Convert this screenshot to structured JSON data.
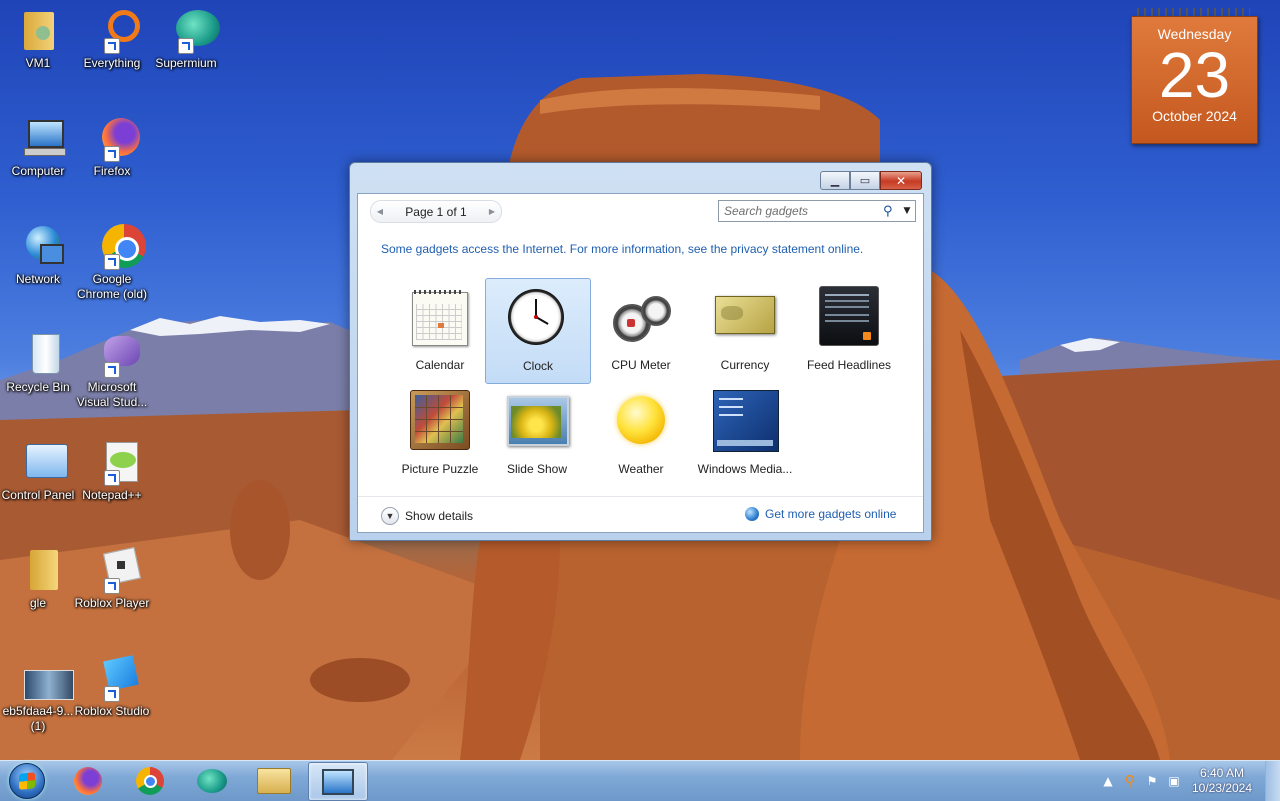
{
  "desktop_icons": [
    {
      "label": "VM1",
      "icon": "folder-user-icon",
      "shortcut": false
    },
    {
      "label": "Everything",
      "icon": "everything-search-icon",
      "shortcut": true
    },
    {
      "label": "Supermium",
      "icon": "supermium-browser-icon",
      "shortcut": true
    },
    {
      "label": "Computer",
      "icon": "computer-icon",
      "shortcut": false
    },
    {
      "label": "Firefox",
      "icon": "firefox-icon",
      "shortcut": true
    },
    {
      "label": "Network",
      "icon": "network-icon",
      "shortcut": false
    },
    {
      "label": "Google Chrome (old)",
      "icon": "chrome-icon",
      "shortcut": true
    },
    {
      "label": "Recycle Bin",
      "icon": "recycle-bin-icon",
      "shortcut": false
    },
    {
      "label": "Microsoft Visual Stud...",
      "icon": "visual-studio-icon",
      "shortcut": true
    },
    {
      "label": "Control Panel",
      "icon": "control-panel-icon",
      "shortcut": false
    },
    {
      "label": "Notepad++",
      "icon": "notepadpp-icon",
      "shortcut": true
    },
    {
      "label": "gle",
      "icon": "folder-icon",
      "shortcut": false
    },
    {
      "label": "Roblox Player",
      "icon": "roblox-player-icon",
      "shortcut": true
    },
    {
      "label": "eb5fdaa4-9... (1)",
      "icon": "image-file-icon",
      "shortcut": false
    },
    {
      "label": "Roblox Studio",
      "icon": "roblox-studio-icon",
      "shortcut": true
    }
  ],
  "calendar_gadget": {
    "weekday": "Wednesday",
    "day": "23",
    "month_year": "October 2024"
  },
  "gadget_window": {
    "pager": {
      "text": "Page 1 of 1"
    },
    "search": {
      "placeholder": "Search gadgets"
    },
    "info_text": "Some gadgets access the Internet.  For more information, see the privacy statement online.",
    "gadgets": [
      {
        "label": "Calendar",
        "icon": "calendar-gadget-icon",
        "selected": false
      },
      {
        "label": "Clock",
        "icon": "clock-gadget-icon",
        "selected": true
      },
      {
        "label": "CPU Meter",
        "icon": "cpu-meter-gadget-icon",
        "selected": false
      },
      {
        "label": "Currency",
        "icon": "currency-gadget-icon",
        "selected": false
      },
      {
        "label": "Feed Headlines",
        "icon": "feed-headlines-gadget-icon",
        "selected": false
      },
      {
        "label": "Picture Puzzle",
        "icon": "picture-puzzle-gadget-icon",
        "selected": false
      },
      {
        "label": "Slide Show",
        "icon": "slide-show-gadget-icon",
        "selected": false
      },
      {
        "label": "Weather",
        "icon": "weather-gadget-icon",
        "selected": false
      },
      {
        "label": "Windows Media...",
        "icon": "windows-media-gadget-icon",
        "selected": false
      }
    ],
    "show_details": "Show details",
    "get_more": "Get more gadgets online"
  },
  "taskbar": {
    "pinned": [
      {
        "icon": "firefox-icon"
      },
      {
        "icon": "chrome-icon"
      },
      {
        "icon": "supermium-browser-icon"
      },
      {
        "icon": "file-explorer-icon"
      },
      {
        "icon": "gadgets-icon",
        "active": true
      }
    ],
    "clock": {
      "time": "6:40 AM",
      "date": "10/23/2024"
    }
  },
  "colors": {
    "accent": "#1f5fb0",
    "calendar": "#d66a2c",
    "selection": "#c3dcf6"
  }
}
